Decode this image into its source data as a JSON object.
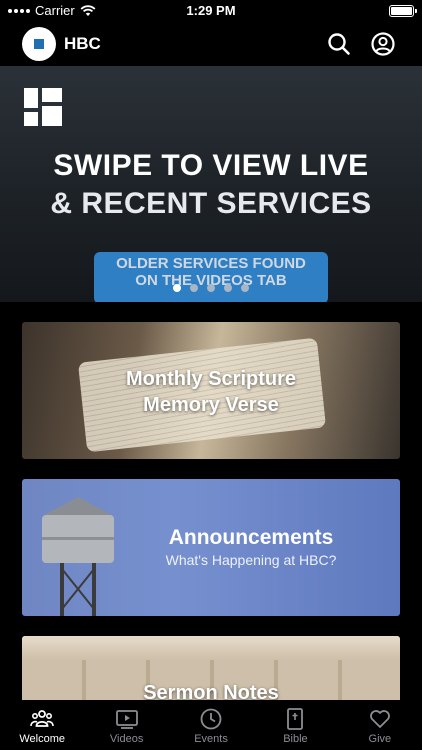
{
  "status_bar": {
    "carrier": "Carrier",
    "time": "1:29 PM"
  },
  "header": {
    "title": "HBC",
    "icons": [
      "search-icon",
      "account-icon"
    ]
  },
  "hero": {
    "line1": "SWIPE TO VIEW LIVE",
    "line2": "& RECENT SERVICES",
    "banner_line1": "OLDER SERVICES FOUND",
    "banner_line2": "ON THE VIDEOS TAB",
    "page_count": 5,
    "active_page": 1
  },
  "cards": [
    {
      "title_line1": "Monthly Scripture",
      "title_line2": "Memory Verse"
    },
    {
      "title": "Announcements",
      "subtitle": "What's Happening at HBC?"
    },
    {
      "title": "Sermon Notes"
    }
  ],
  "tabs": [
    {
      "label": "Welcome",
      "icon": "people-icon",
      "active": true
    },
    {
      "label": "Videos",
      "icon": "video-icon",
      "active": false
    },
    {
      "label": "Events",
      "icon": "clock-icon",
      "active": false
    },
    {
      "label": "Bible",
      "icon": "bible-icon",
      "active": false
    },
    {
      "label": "Give",
      "icon": "heart-icon",
      "active": false
    }
  ],
  "colors": {
    "background": "#000000",
    "banner": "#2f7fc4",
    "tab_inactive": "#8d8d93",
    "tab_active": "#ffffff"
  }
}
